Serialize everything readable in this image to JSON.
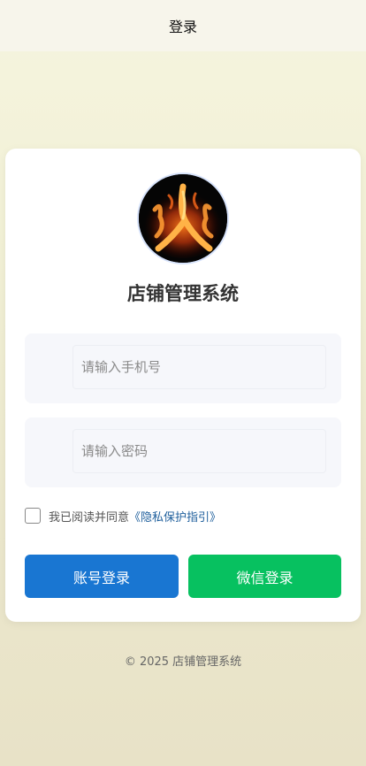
{
  "header": {
    "title": "登录"
  },
  "app": {
    "name": "店铺管理系统",
    "logo_icon": "flame-character-logo"
  },
  "form": {
    "phone": {
      "placeholder": "请输入手机号",
      "value": ""
    },
    "password": {
      "placeholder": "请输入密码",
      "value": ""
    },
    "agreement": {
      "checked": false,
      "text": "我已阅读并同意",
      "link": "《隐私保护指引》"
    }
  },
  "buttons": {
    "account_login": "账号登录",
    "wechat_login": "微信登录"
  },
  "footer": {
    "copyright": "© 2025 店铺管理系统"
  },
  "colors": {
    "primary_blue": "#1976d2",
    "wechat_green": "#07c160",
    "link": "#1f5f9c",
    "card_bg": "#ffffff",
    "field_bg": "#f6f7fb"
  }
}
